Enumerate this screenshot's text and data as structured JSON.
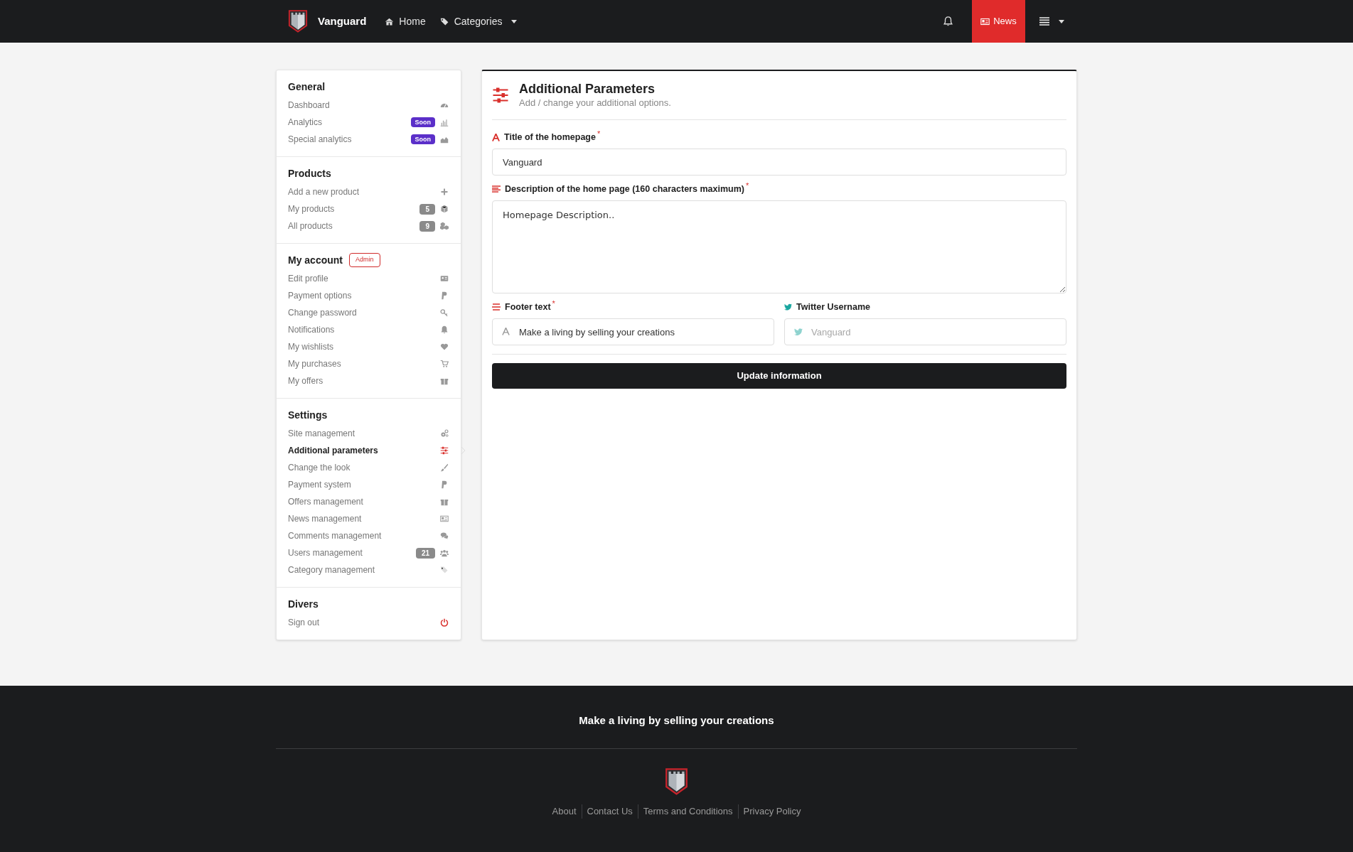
{
  "navbar": {
    "brand": "Vanguard",
    "links": [
      {
        "label": "Home",
        "dropdown": false
      },
      {
        "label": "Categories",
        "dropdown": true
      }
    ],
    "news_button": {
      "label": "News"
    }
  },
  "sidebar": {
    "sections": [
      {
        "title": "General",
        "items": [
          {
            "label": "Dashboard",
            "selected": false
          },
          {
            "label": "Analytics",
            "selected": false,
            "badge": {
              "kind": "soon",
              "text": "Soon"
            }
          },
          {
            "label": "Special analytics",
            "selected": false,
            "badge": {
              "kind": "soon",
              "text": "Soon"
            }
          }
        ]
      },
      {
        "title": "Products",
        "items": [
          {
            "label": "Add a new product",
            "selected": false
          },
          {
            "label": "My products",
            "selected": false,
            "badge": {
              "kind": "count",
              "text": "5"
            }
          },
          {
            "label": "All products",
            "selected": false,
            "badge": {
              "kind": "count",
              "text": "9"
            }
          }
        ]
      },
      {
        "title": "My account",
        "tag": "Admin",
        "items": [
          {
            "label": "Edit profile",
            "selected": false
          },
          {
            "label": "Payment options",
            "selected": false
          },
          {
            "label": "Change password",
            "selected": false
          },
          {
            "label": "Notifications",
            "selected": false
          },
          {
            "label": "My wishlists",
            "selected": false
          },
          {
            "label": "My purchases",
            "selected": false
          },
          {
            "label": "My offers",
            "selected": false
          }
        ]
      },
      {
        "title": "Settings",
        "items": [
          {
            "label": "Site management",
            "selected": false
          },
          {
            "label": "Additional parameters",
            "selected": true
          },
          {
            "label": "Change the look",
            "selected": false
          },
          {
            "label": "Payment system",
            "selected": false
          },
          {
            "label": "Offers management",
            "selected": false
          },
          {
            "label": "News management",
            "selected": false
          },
          {
            "label": "Comments management",
            "selected": false
          },
          {
            "label": "Users management",
            "selected": false,
            "badge": {
              "kind": "count",
              "text": "21"
            }
          },
          {
            "label": "Category management",
            "selected": false
          }
        ]
      },
      {
        "title": "Divers",
        "items": [
          {
            "label": "Sign out",
            "selected": false
          }
        ]
      }
    ]
  },
  "form": {
    "title": "Additional Parameters",
    "subtitle": "Add / change your additional options.",
    "rows": [
      [
        {
          "kind": "text",
          "label": "Title of the homepage",
          "required_mark": "*",
          "value": "Vanguard"
        }
      ],
      [
        {
          "kind": "textarea",
          "label": "Description of the home page (160 characters maximum)",
          "required_mark": "*",
          "value": "Homepage Description.."
        }
      ],
      [
        {
          "kind": "text",
          "label": "Footer text",
          "required_mark": "*",
          "value": "Make a living by selling your creations"
        },
        {
          "kind": "text",
          "label": "Twitter Username",
          "placeholder": "Vanguard"
        }
      ]
    ],
    "submit_button": "Update information"
  },
  "footer": {
    "tagline": "Make a living by selling your creations",
    "links": [
      "About",
      "Contact Us",
      "Terms and Conditions",
      "Privacy Policy"
    ]
  }
}
